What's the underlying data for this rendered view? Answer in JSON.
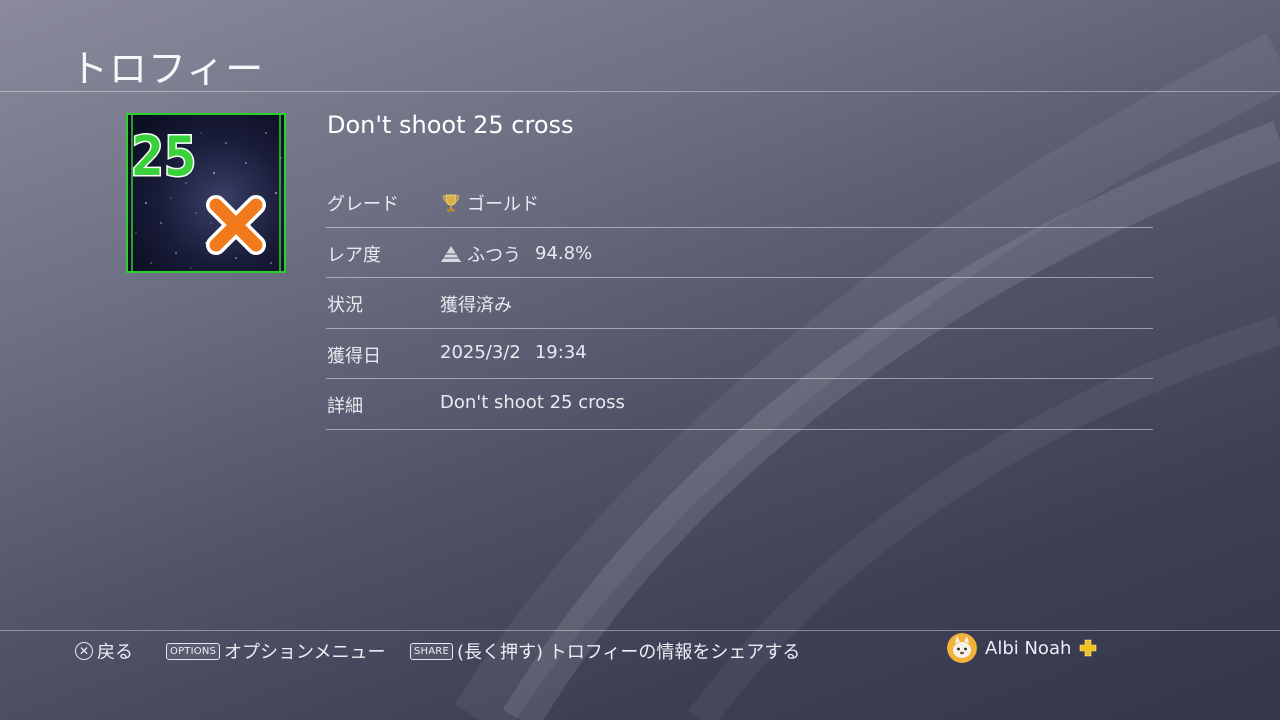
{
  "header": {
    "title": "トロフィー"
  },
  "trophy": {
    "name": "Don't shoot 25 cross",
    "art": {
      "number": "25",
      "mark": "✕"
    }
  },
  "details": [
    {
      "label": "グレード",
      "value": "ゴールド",
      "icon": "gold-trophy-icon"
    },
    {
      "label": "レア度",
      "value": "ふつう",
      "extra": "94.8%",
      "icon": "rarity-common-icon"
    },
    {
      "label": "状況",
      "value": "獲得済み"
    },
    {
      "label": "獲得日",
      "value": "2025/3/2",
      "extra": "19:34"
    },
    {
      "label": "詳細",
      "value": "Don't shoot 25 cross"
    }
  ],
  "footer": {
    "back_label": "戻る",
    "options_badge": "OPTIONS",
    "options_label": "オプションメニュー",
    "share_badge": "SHARE",
    "share_label": "(長く押す) トロフィーの情報をシェアする",
    "user_name": "Albi Noah",
    "icons": {
      "back": "cross-button-icon",
      "plus": "playstation-plus-icon",
      "avatar": "user-avatar-icon"
    }
  },
  "colors": {
    "accent_green": "#3ad23a",
    "accent_orange": "#f07a1c",
    "plus_yellow": "#f2c21a"
  }
}
